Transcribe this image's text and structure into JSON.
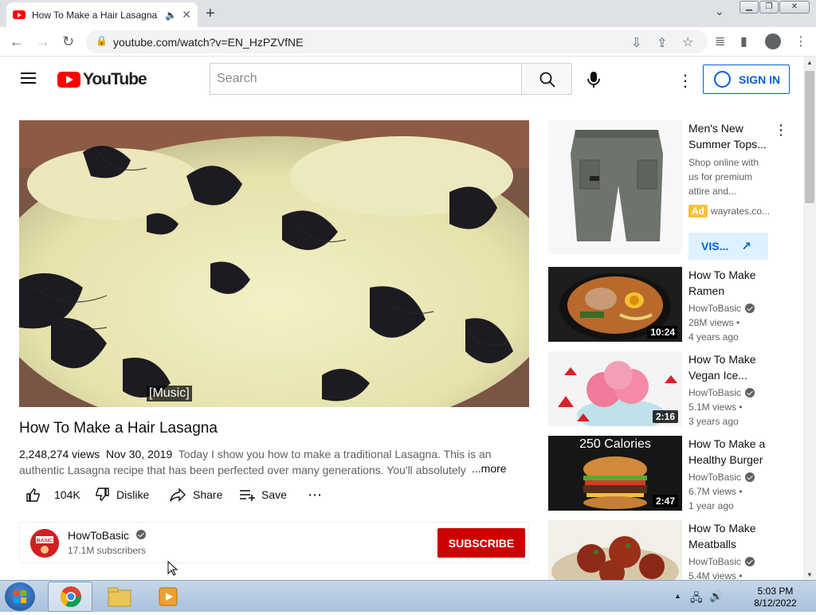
{
  "browser": {
    "tab_title": "How To Make a Hair Lasagna",
    "url": "youtube.com/watch?v=EN_HzPZVfNE"
  },
  "header": {
    "logo_text": "YouTube",
    "search_placeholder": "Search",
    "sign_in": "SIGN IN"
  },
  "video": {
    "caption": "[Music]",
    "title": "How To Make a Hair Lasagna",
    "views": "2,248,274 views",
    "date": "Nov 30, 2019",
    "description": "Today I show you how to make a traditional Lasagna. This is an authentic Lasagna recipe that has been perfected over many generations. You'll absolutely",
    "more": "...more",
    "likes": "104K",
    "dislike": "Dislike",
    "share": "Share",
    "save": "Save"
  },
  "channel": {
    "name": "HowToBasic",
    "subscribers": "17.1M subscribers",
    "avatar_text": "BASIC",
    "subscribe": "SUBSCRIBE"
  },
  "ad": {
    "title": "Men's New Summer Tops...",
    "body": "Shop online with us for premium attire and...",
    "badge": "Ad",
    "domain": "wayrates.co...",
    "visit": "VIS..."
  },
  "related": [
    {
      "title": "How To Make Ramen",
      "channel": "HowToBasic",
      "views": "28M views •",
      "age": "4 years ago",
      "duration": "10:24"
    },
    {
      "title": "How To Make Vegan Ice...",
      "channel": "HowToBasic",
      "views": "5.1M views •",
      "age": "3 years ago",
      "duration": "2:16"
    },
    {
      "title": "How To Make a Healthy Burger",
      "channel": "HowToBasic",
      "views": "6.7M views •",
      "age": "1 year ago",
      "duration": "2:47",
      "thumb_text": "250 Calories"
    },
    {
      "title": "How To Make Meatballs",
      "channel": "HowToBasic",
      "views": "5.4M views •",
      "age": "",
      "duration": ""
    }
  ],
  "taskbar": {
    "time": "5:03 PM",
    "date": "8/12/2022"
  }
}
